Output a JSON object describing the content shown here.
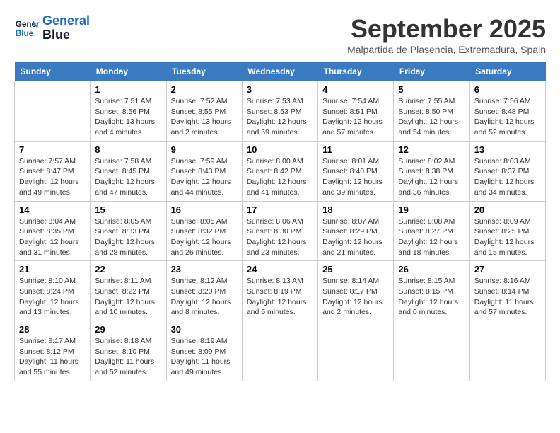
{
  "header": {
    "logo_line1": "General",
    "logo_line2": "Blue",
    "month": "September 2025",
    "location": "Malpartida de Plasencia, Extremadura, Spain"
  },
  "days_of_week": [
    "Sunday",
    "Monday",
    "Tuesday",
    "Wednesday",
    "Thursday",
    "Friday",
    "Saturday"
  ],
  "weeks": [
    [
      {
        "day": "",
        "info": ""
      },
      {
        "day": "1",
        "info": "Sunrise: 7:51 AM\nSunset: 8:56 PM\nDaylight: 13 hours\nand 4 minutes."
      },
      {
        "day": "2",
        "info": "Sunrise: 7:52 AM\nSunset: 8:55 PM\nDaylight: 13 hours\nand 2 minutes."
      },
      {
        "day": "3",
        "info": "Sunrise: 7:53 AM\nSunset: 8:53 PM\nDaylight: 12 hours\nand 59 minutes."
      },
      {
        "day": "4",
        "info": "Sunrise: 7:54 AM\nSunset: 8:51 PM\nDaylight: 12 hours\nand 57 minutes."
      },
      {
        "day": "5",
        "info": "Sunrise: 7:55 AM\nSunset: 8:50 PM\nDaylight: 12 hours\nand 54 minutes."
      },
      {
        "day": "6",
        "info": "Sunrise: 7:56 AM\nSunset: 8:48 PM\nDaylight: 12 hours\nand 52 minutes."
      }
    ],
    [
      {
        "day": "7",
        "info": "Sunrise: 7:57 AM\nSunset: 8:47 PM\nDaylight: 12 hours\nand 49 minutes."
      },
      {
        "day": "8",
        "info": "Sunrise: 7:58 AM\nSunset: 8:45 PM\nDaylight: 12 hours\nand 47 minutes."
      },
      {
        "day": "9",
        "info": "Sunrise: 7:59 AM\nSunset: 8:43 PM\nDaylight: 12 hours\nand 44 minutes."
      },
      {
        "day": "10",
        "info": "Sunrise: 8:00 AM\nSunset: 8:42 PM\nDaylight: 12 hours\nand 41 minutes."
      },
      {
        "day": "11",
        "info": "Sunrise: 8:01 AM\nSunset: 8:40 PM\nDaylight: 12 hours\nand 39 minutes."
      },
      {
        "day": "12",
        "info": "Sunrise: 8:02 AM\nSunset: 8:38 PM\nDaylight: 12 hours\nand 36 minutes."
      },
      {
        "day": "13",
        "info": "Sunrise: 8:03 AM\nSunset: 8:37 PM\nDaylight: 12 hours\nand 34 minutes."
      }
    ],
    [
      {
        "day": "14",
        "info": "Sunrise: 8:04 AM\nSunset: 8:35 PM\nDaylight: 12 hours\nand 31 minutes."
      },
      {
        "day": "15",
        "info": "Sunrise: 8:05 AM\nSunset: 8:33 PM\nDaylight: 12 hours\nand 28 minutes."
      },
      {
        "day": "16",
        "info": "Sunrise: 8:05 AM\nSunset: 8:32 PM\nDaylight: 12 hours\nand 26 minutes."
      },
      {
        "day": "17",
        "info": "Sunrise: 8:06 AM\nSunset: 8:30 PM\nDaylight: 12 hours\nand 23 minutes."
      },
      {
        "day": "18",
        "info": "Sunrise: 8:07 AM\nSunset: 8:29 PM\nDaylight: 12 hours\nand 21 minutes."
      },
      {
        "day": "19",
        "info": "Sunrise: 8:08 AM\nSunset: 8:27 PM\nDaylight: 12 hours\nand 18 minutes."
      },
      {
        "day": "20",
        "info": "Sunrise: 8:09 AM\nSunset: 8:25 PM\nDaylight: 12 hours\nand 15 minutes."
      }
    ],
    [
      {
        "day": "21",
        "info": "Sunrise: 8:10 AM\nSunset: 8:24 PM\nDaylight: 12 hours\nand 13 minutes."
      },
      {
        "day": "22",
        "info": "Sunrise: 8:11 AM\nSunset: 8:22 PM\nDaylight: 12 hours\nand 10 minutes."
      },
      {
        "day": "23",
        "info": "Sunrise: 8:12 AM\nSunset: 8:20 PM\nDaylight: 12 hours\nand 8 minutes."
      },
      {
        "day": "24",
        "info": "Sunrise: 8:13 AM\nSunset: 8:19 PM\nDaylight: 12 hours\nand 5 minutes."
      },
      {
        "day": "25",
        "info": "Sunrise: 8:14 AM\nSunset: 8:17 PM\nDaylight: 12 hours\nand 2 minutes."
      },
      {
        "day": "26",
        "info": "Sunrise: 8:15 AM\nSunset: 8:15 PM\nDaylight: 12 hours\nand 0 minutes."
      },
      {
        "day": "27",
        "info": "Sunrise: 8:16 AM\nSunset: 8:14 PM\nDaylight: 11 hours\nand 57 minutes."
      }
    ],
    [
      {
        "day": "28",
        "info": "Sunrise: 8:17 AM\nSunset: 8:12 PM\nDaylight: 11 hours\nand 55 minutes."
      },
      {
        "day": "29",
        "info": "Sunrise: 8:18 AM\nSunset: 8:10 PM\nDaylight: 11 hours\nand 52 minutes."
      },
      {
        "day": "30",
        "info": "Sunrise: 8:19 AM\nSunset: 8:09 PM\nDaylight: 11 hours\nand 49 minutes."
      },
      {
        "day": "",
        "info": ""
      },
      {
        "day": "",
        "info": ""
      },
      {
        "day": "",
        "info": ""
      },
      {
        "day": "",
        "info": ""
      }
    ]
  ]
}
